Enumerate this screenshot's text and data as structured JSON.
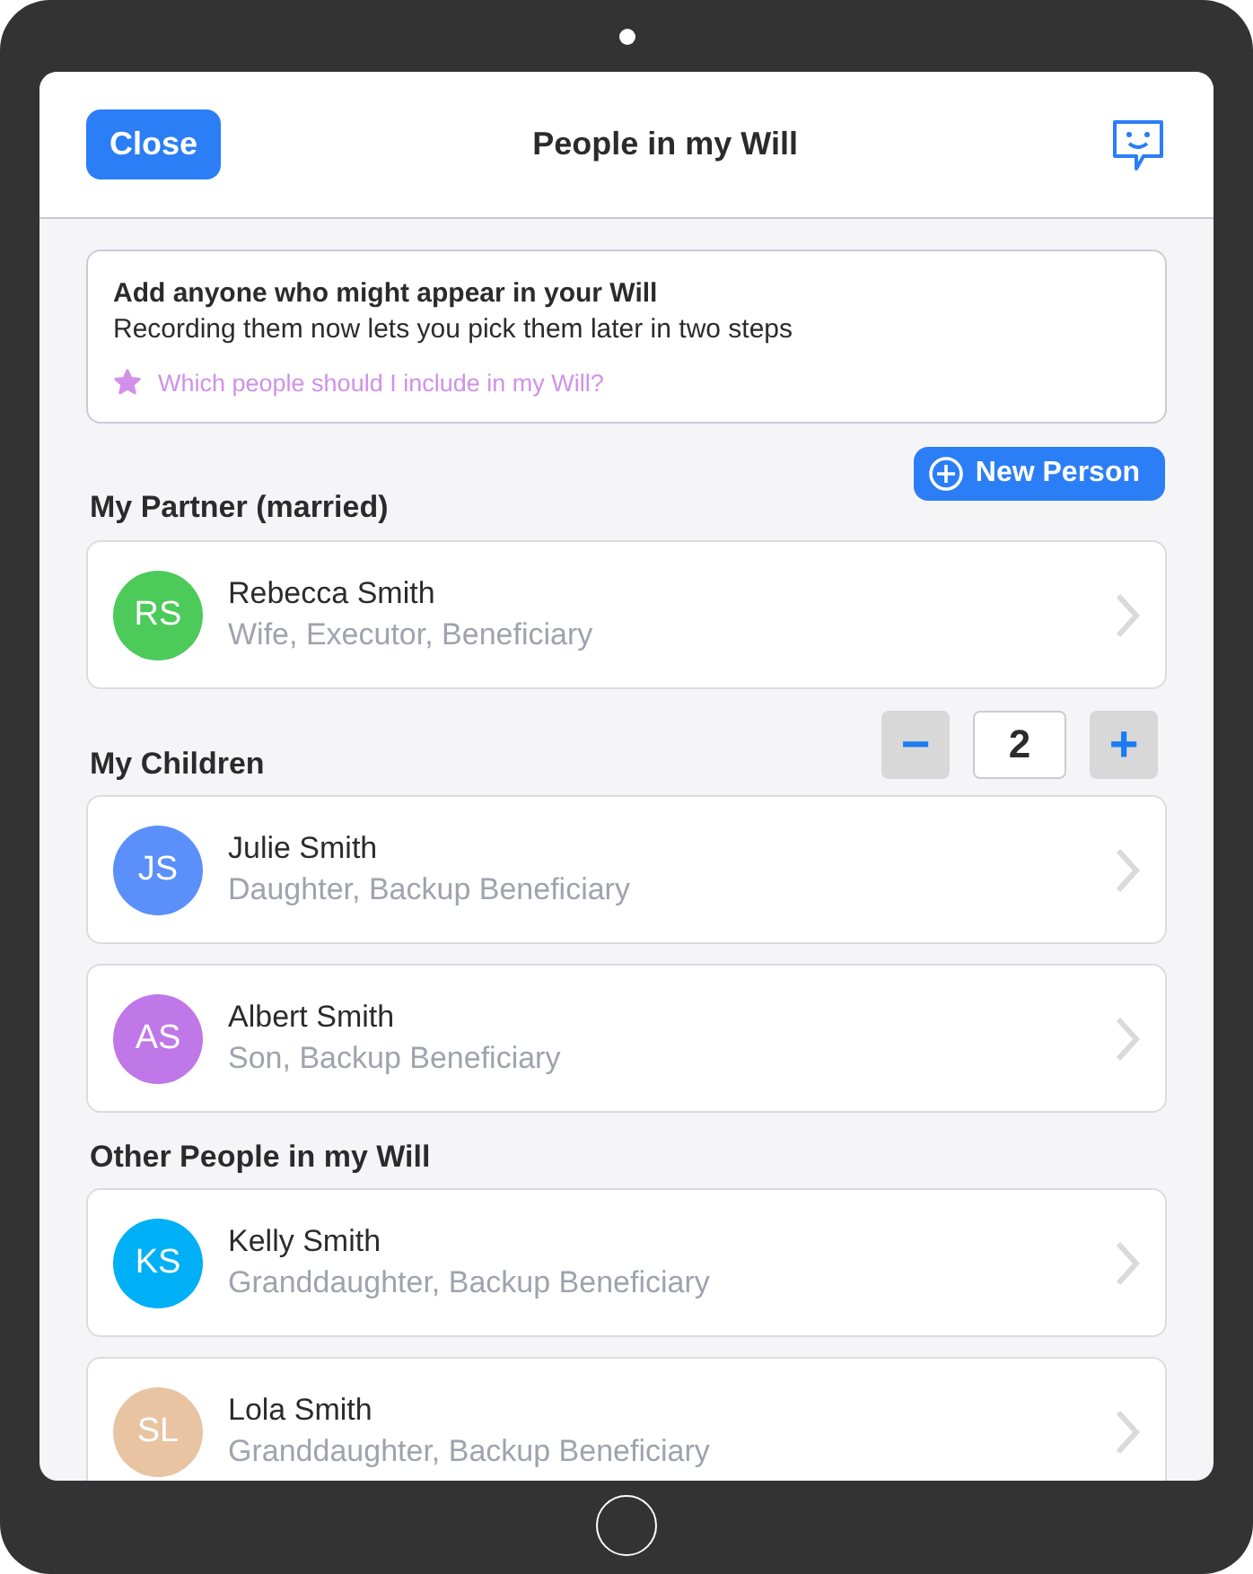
{
  "header": {
    "close_button": "Close",
    "title": "People in my Will"
  },
  "info_card": {
    "heading": "Add anyone who might appear in your Will",
    "text": "Recording them now lets you pick them later in two steps",
    "help_link": "Which people should I include in my Will?"
  },
  "new_person_button": "New Person",
  "sections": [
    {
      "title": "My Partner (married)",
      "people": [
        {
          "initials": "RS",
          "name": "Rebecca Smith",
          "roles": "Wife, Executor, Beneficiary",
          "color": "#4cca5a"
        }
      ]
    },
    {
      "title": "My Children",
      "counter": {
        "minus": "−",
        "value": "2",
        "plus": "+"
      },
      "people": [
        {
          "initials": "JS",
          "name": "Julie Smith",
          "roles": "Daughter, Backup Beneficiary",
          "color": "#5b8ff9"
        },
        {
          "initials": "AS",
          "name": "Albert Smith",
          "roles": "Son, Backup Beneficiary",
          "color": "#c077e8"
        }
      ]
    },
    {
      "title": "Other People in my Will",
      "people": [
        {
          "initials": "KS",
          "name": "Kelly Smith",
          "roles": "Granddaughter, Backup Beneficiary",
          "color": "#00b0f6"
        },
        {
          "initials": "SL",
          "name": "Lola Smith",
          "roles": "Granddaughter, Backup Beneficiary",
          "color": "#e8c4a2"
        }
      ]
    }
  ]
}
